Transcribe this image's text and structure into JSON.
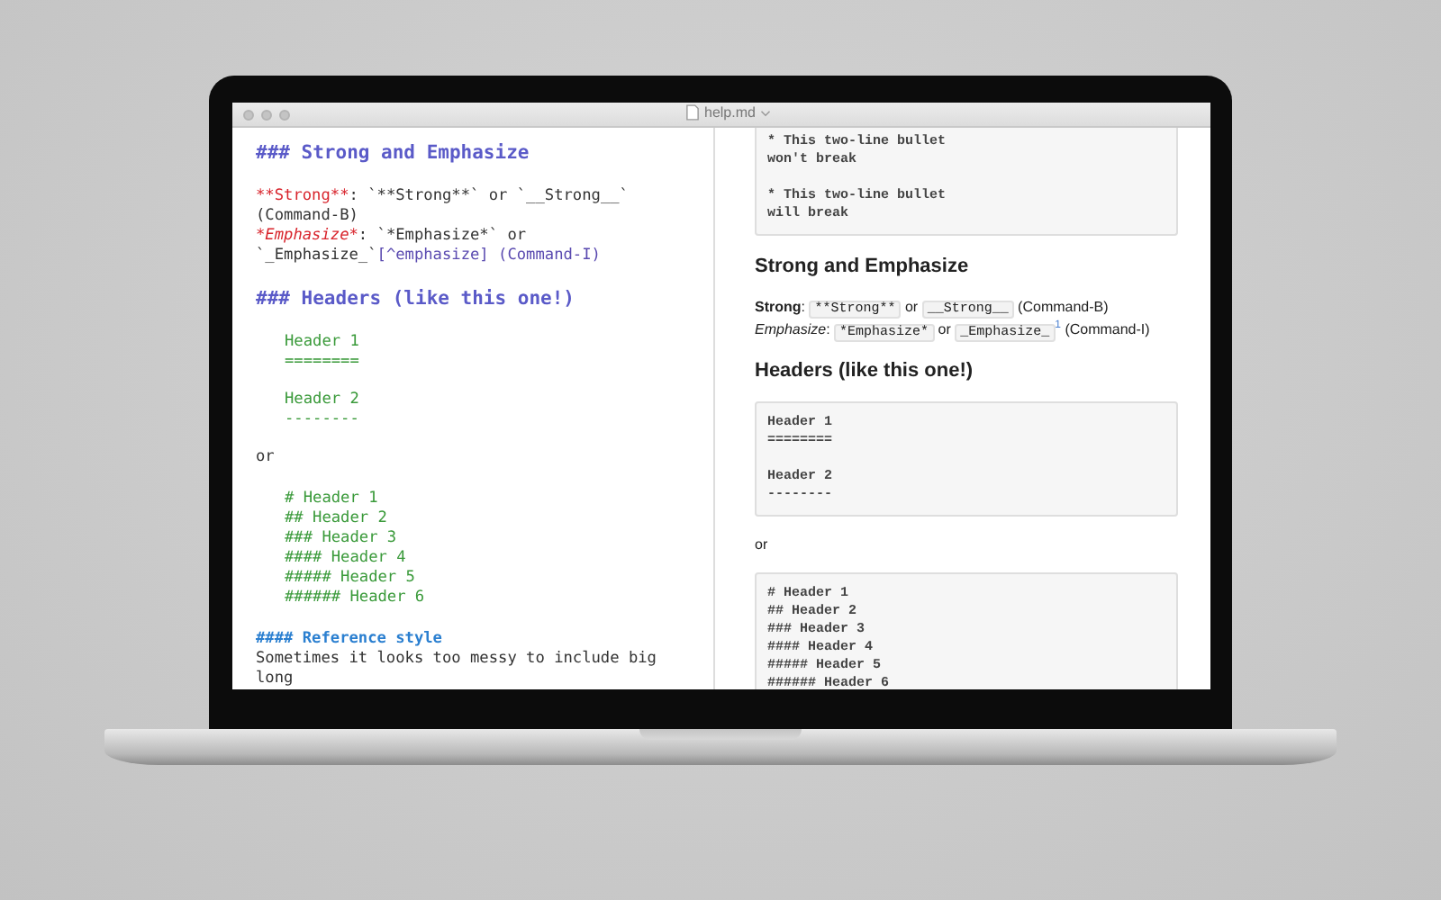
{
  "window": {
    "title": "help.md"
  },
  "editor": {
    "blocks": [
      {
        "kind": "h3",
        "lines": [
          [
            {
              "kind": "plain",
              "text": "### Strong and Emphasize"
            }
          ]
        ]
      },
      {
        "kind": "text",
        "lines": [
          [
            {
              "kind": "strong",
              "text": "**Strong**"
            },
            {
              "kind": "plain",
              "text": ": `**Strong**` or `__Strong__` (Command-B)"
            }
          ],
          [
            {
              "kind": "emph",
              "text": "*Emphasize*"
            },
            {
              "kind": "plain",
              "text": ": `*Emphasize*` or `_Emphasize_`"
            },
            {
              "kind": "link",
              "text": "[^emphasize] (Command-I)"
            }
          ]
        ]
      },
      {
        "kind": "h3",
        "lines": [
          [
            {
              "kind": "plain",
              "text": "### Headers (like this one!)"
            }
          ]
        ]
      },
      {
        "kind": "code",
        "lines": [
          [
            {
              "kind": "plain",
              "text": "Header 1"
            }
          ],
          [
            {
              "kind": "plain",
              "text": "========"
            }
          ]
        ]
      },
      {
        "kind": "code",
        "lines": [
          [
            {
              "kind": "plain",
              "text": "Header 2"
            }
          ],
          [
            {
              "kind": "plain",
              "text": "--------"
            }
          ]
        ]
      },
      {
        "kind": "text",
        "lines": [
          [
            {
              "kind": "plain",
              "text": "or"
            }
          ]
        ]
      },
      {
        "kind": "code",
        "lines": [
          [
            {
              "kind": "plain",
              "text": "# Header 1"
            }
          ],
          [
            {
              "kind": "plain",
              "text": "## Header 2"
            }
          ],
          [
            {
              "kind": "plain",
              "text": "### Header 3"
            }
          ],
          [
            {
              "kind": "plain",
              "text": "#### Header 4"
            }
          ],
          [
            {
              "kind": "plain",
              "text": "##### Header 5"
            }
          ],
          [
            {
              "kind": "plain",
              "text": "###### Header 6"
            }
          ]
        ]
      },
      {
        "kind": "h4",
        "lines": [
          [
            {
              "kind": "plain",
              "text": "#### Reference style"
            }
          ]
        ]
      },
      {
        "kind": "text",
        "lines": [
          [
            {
              "kind": "plain",
              "text": "Sometimes it looks too messy to include big long"
            }
          ]
        ]
      }
    ]
  },
  "preview": {
    "blocks": [
      {
        "kind": "code",
        "groups": [
          [
            "* This two-line bullet",
            "won't break"
          ],
          [
            "* This two-line bullet",
            "will break"
          ]
        ]
      },
      {
        "kind": "heading",
        "text": "Strong and Emphasize"
      },
      {
        "kind": "paragraph",
        "lines": [
          [
            {
              "kind": "bold",
              "text": "Strong"
            },
            {
              "kind": "plain",
              "text": ": "
            },
            {
              "kind": "code",
              "text": "**Strong**"
            },
            {
              "kind": "plain",
              "text": " or "
            },
            {
              "kind": "code",
              "text": "__Strong__"
            },
            {
              "kind": "plain",
              "text": " (Command-B)"
            }
          ],
          [
            {
              "kind": "italic",
              "text": "Emphasize"
            },
            {
              "kind": "plain",
              "text": ": "
            },
            {
              "kind": "code",
              "text": "*Emphasize*"
            },
            {
              "kind": "plain",
              "text": " or "
            },
            {
              "kind": "code",
              "text": "_Emphasize_"
            },
            {
              "kind": "sup",
              "text": "1"
            },
            {
              "kind": "plain",
              "text": " (Command-I)"
            }
          ]
        ]
      },
      {
        "kind": "heading",
        "text": "Headers (like this one!)"
      },
      {
        "kind": "code",
        "groups": [
          [
            "Header 1",
            "========"
          ],
          [
            "Header 2",
            "--------"
          ]
        ]
      },
      {
        "kind": "paragraph",
        "lines": [
          [
            {
              "kind": "plain",
              "text": "or"
            }
          ]
        ]
      },
      {
        "kind": "code",
        "groups": [
          [
            "# Header 1",
            "## Header 2",
            "### Header 3",
            "#### Header 4",
            "##### Header 5",
            "###### Header 6"
          ]
        ]
      }
    ]
  }
}
